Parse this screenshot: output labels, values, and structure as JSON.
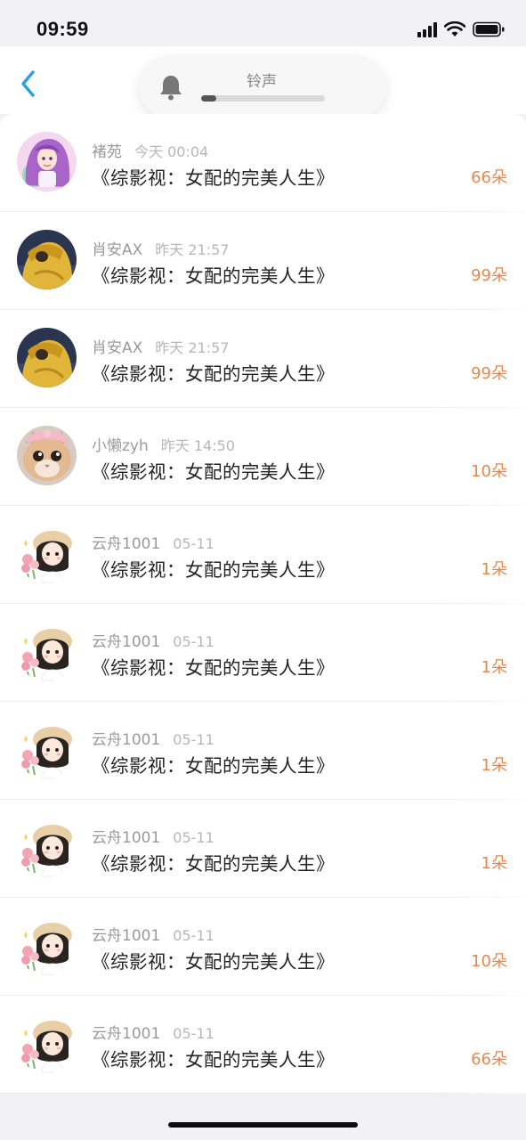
{
  "status_bar": {
    "time": "09:59"
  },
  "ringtone": {
    "label": "铃声",
    "volume_percent": 12
  },
  "rows": [
    {
      "user": "褚苑",
      "time": "今天 00:04",
      "title": "《综影视：女配的完美人生》",
      "amount": "66朵",
      "avatar": "purple-hair-anime-avatar"
    },
    {
      "user": "肖安AX",
      "time": "昨天 21:57",
      "title": "《综影视：女配的完美人生》",
      "amount": "99朵",
      "avatar": "yellow-hoodie-avatar"
    },
    {
      "user": "肖安AX",
      "time": "昨天 21:57",
      "title": "《综影视：女配的完美人生》",
      "amount": "99朵",
      "avatar": "yellow-hoodie-avatar"
    },
    {
      "user": "小懒zyh",
      "time": "昨天 14:50",
      "title": "《综影视：女配的完美人生》",
      "amount": "10朵",
      "avatar": "cat-avatar"
    },
    {
      "user": "云舟1001",
      "time": "05-11",
      "title": "《综影视：女配的完美人生》",
      "amount": "1朵",
      "avatar": "girl-straw-hat-avatar"
    },
    {
      "user": "云舟1001",
      "time": "05-11",
      "title": "《综影视：女配的完美人生》",
      "amount": "1朵",
      "avatar": "girl-straw-hat-avatar"
    },
    {
      "user": "云舟1001",
      "time": "05-11",
      "title": "《综影视：女配的完美人生》",
      "amount": "1朵",
      "avatar": "girl-straw-hat-avatar"
    },
    {
      "user": "云舟1001",
      "time": "05-11",
      "title": "《综影视：女配的完美人生》",
      "amount": "1朵",
      "avatar": "girl-straw-hat-avatar"
    },
    {
      "user": "云舟1001",
      "time": "05-11",
      "title": "《综影视：女配的完美人生》",
      "amount": "10朵",
      "avatar": "girl-straw-hat-avatar"
    },
    {
      "user": "云舟1001",
      "time": "05-11",
      "title": "《综影视：女配的完美人生》",
      "amount": "66朵",
      "avatar": "girl-straw-hat-avatar"
    }
  ],
  "colors": {
    "accent": "#e8874a",
    "back_arrow": "#2a9fe8"
  }
}
